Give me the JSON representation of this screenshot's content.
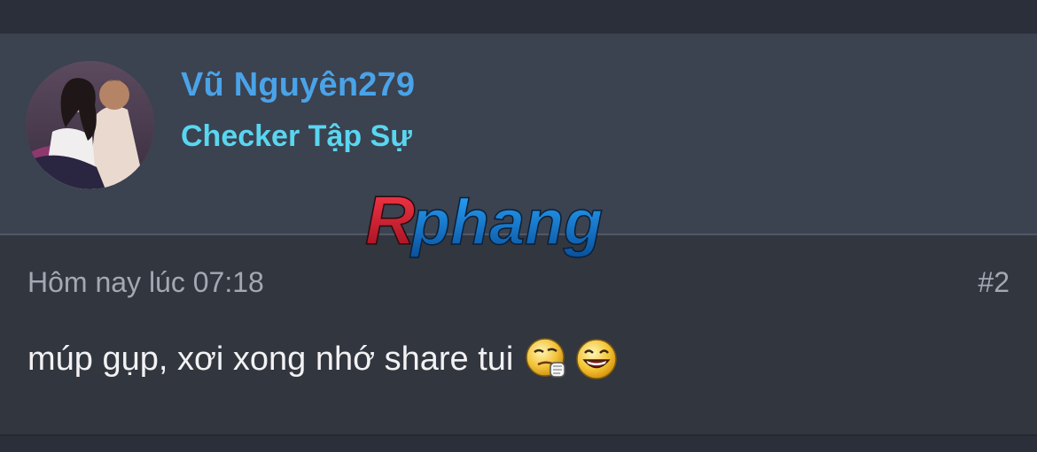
{
  "post": {
    "author": {
      "name": "Vũ Nguyên279",
      "title": "Checker Tập Sự"
    },
    "timestamp": "Hôm nay lúc 07:18",
    "number": "#2",
    "message": "múp gụp, xơi xong nhớ share tui",
    "emojis": [
      "thinking-smiley-icon",
      "laughing-smiley-icon"
    ]
  },
  "watermark": {
    "text": "Rphang"
  },
  "colors": {
    "username": "#4aa3e8",
    "user_title": "#59d6f0",
    "header_bg": "#3b4250",
    "body_bg": "#32363f",
    "page_bg": "#2b2f3a"
  }
}
